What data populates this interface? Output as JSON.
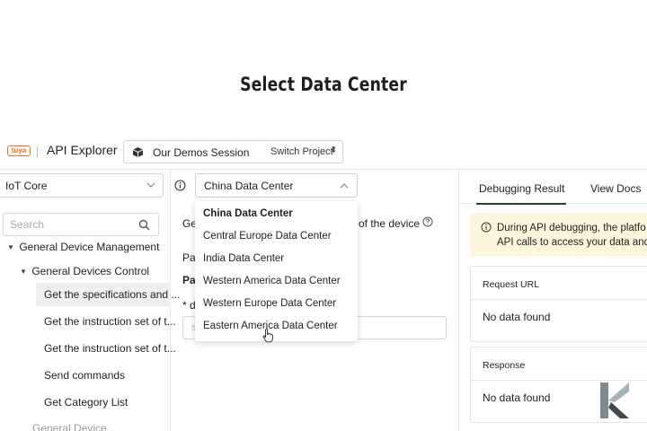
{
  "video_title": "Select Data Center",
  "header": {
    "logo_text": "tuya",
    "app_title": "API Explorer",
    "project_name": "Our Demos Session",
    "switch_project": "Switch Project"
  },
  "sidebar": {
    "product_select": "IoT Core",
    "search_placeholder": "Search",
    "tree": [
      "General Device Management",
      "General Devices Control",
      "Get the specifications and ...",
      "Get the instruction set of t...",
      "Get the instruction set of t...",
      "Send commands",
      "Get Category List",
      "General Device..."
    ]
  },
  "data_center": {
    "selected": "China Data Center",
    "options": [
      "China Data Center",
      "Central Europe Data Center",
      "India Data Center",
      "Western America Data Center",
      "Western Europe Data Center",
      "Eastern America Data Center"
    ]
  },
  "middle": {
    "desc_prefix": "Ge",
    "desc_suffix": "of the device",
    "params_label": "Pa",
    "params_bold": "Pa",
    "field_label": "* d",
    "input_placeholder": "s"
  },
  "right": {
    "tabs": [
      "Debugging Result",
      "View Docs"
    ],
    "banner_line1": "During API debugging, the platfo",
    "banner_line2": "API calls to access your data and",
    "request_url_label": "Request URL",
    "request_url_value": "No data found",
    "response_label": "Response",
    "response_value": "No data found"
  },
  "colors": {
    "brand": "#ff6a1a",
    "banner_bg": "#fdf6dd",
    "active_row_bg": "#f0f0f0"
  }
}
